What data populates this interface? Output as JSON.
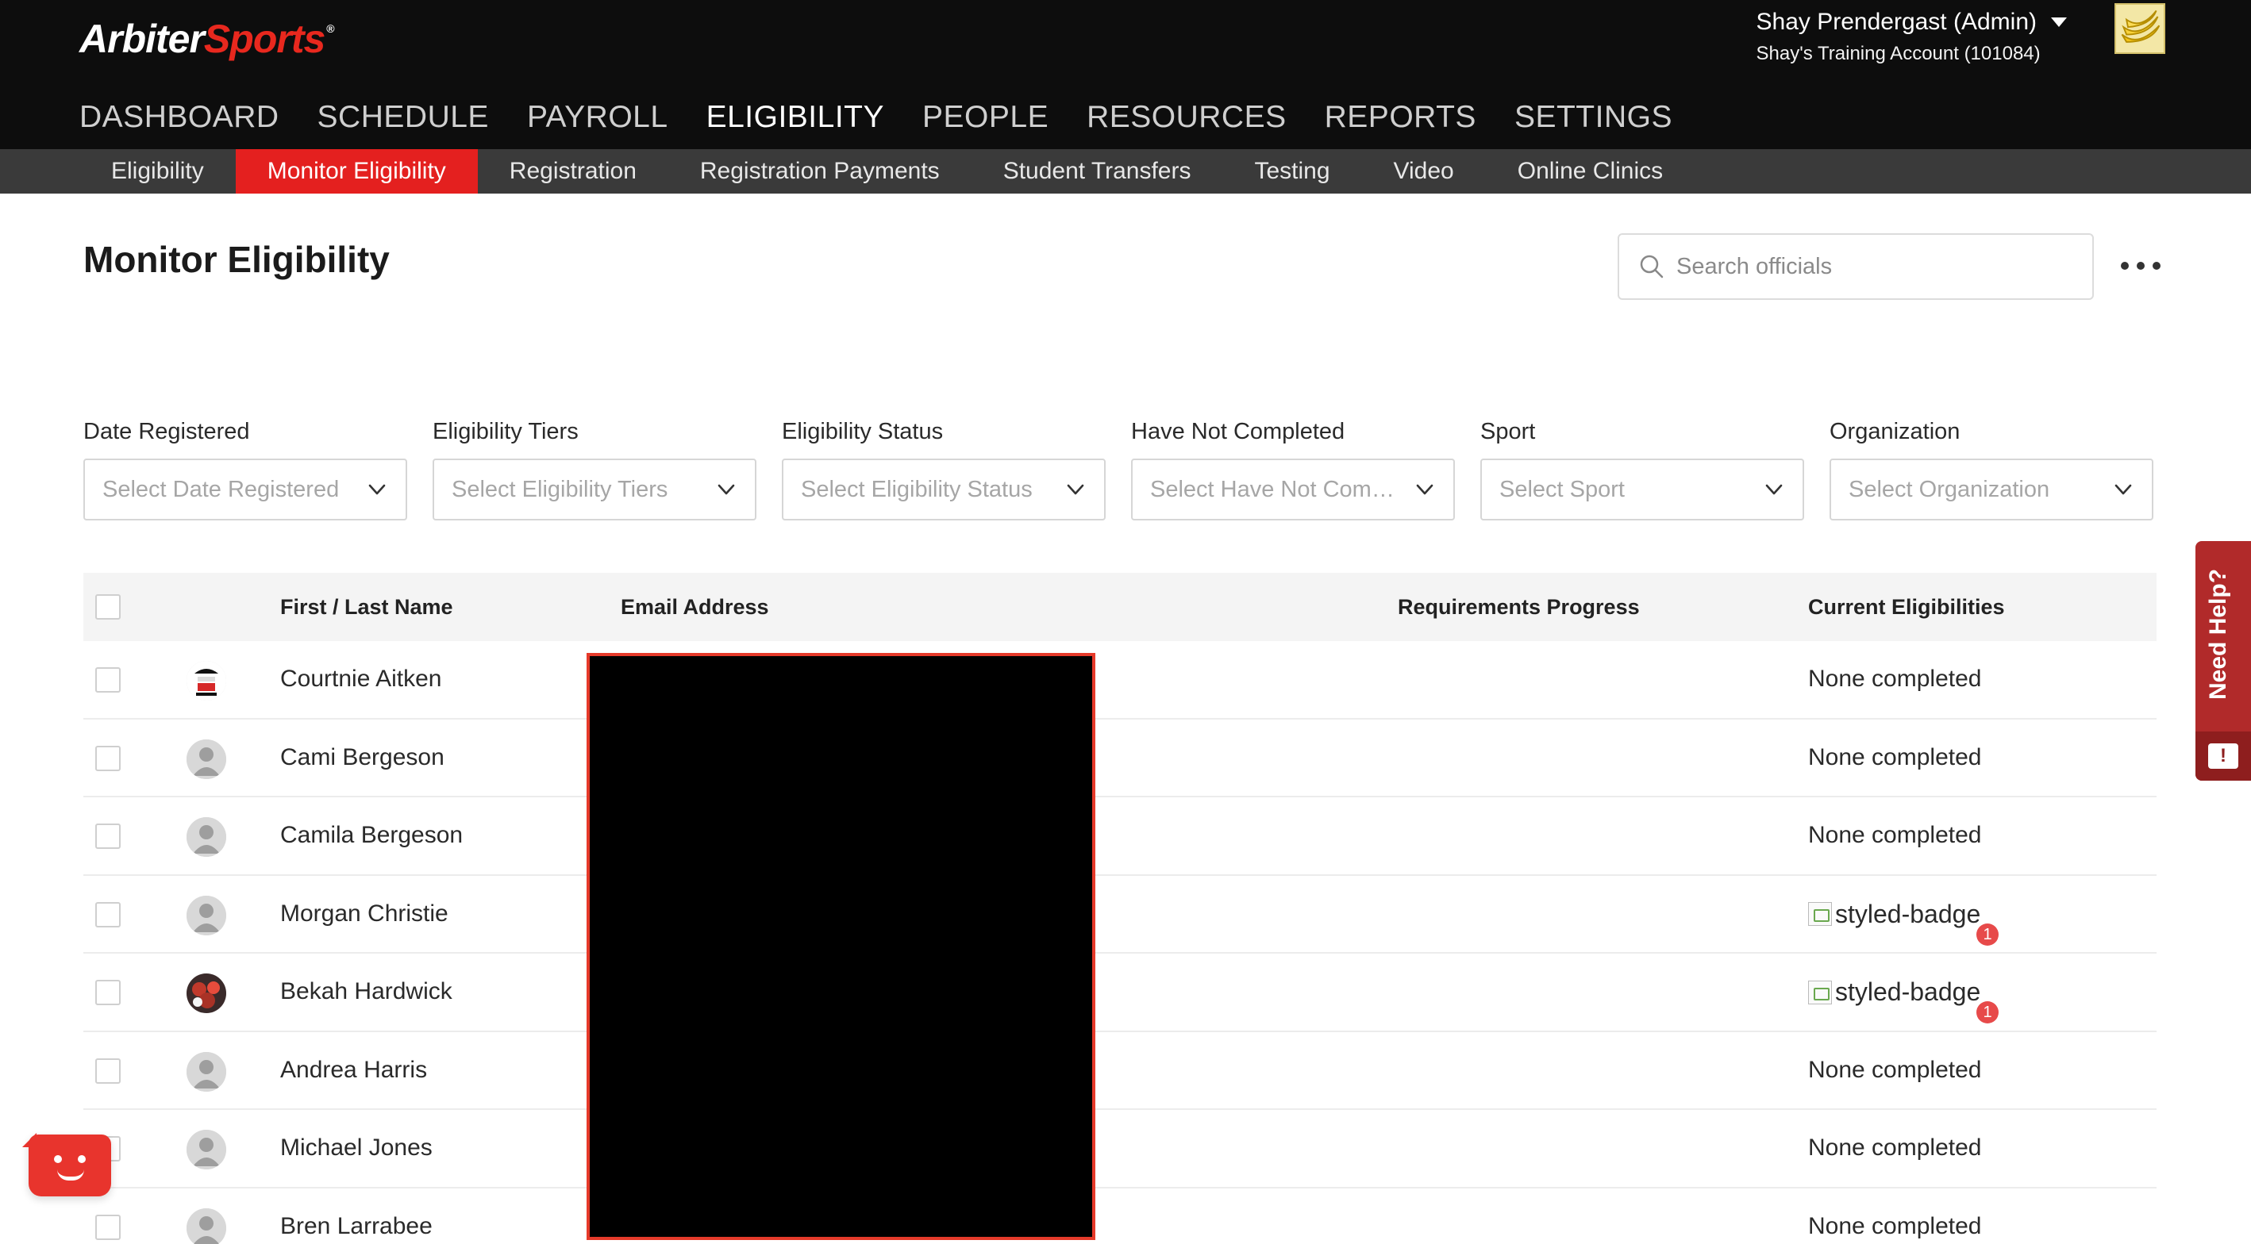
{
  "app": {
    "logo_part1": "Arbiter",
    "logo_part2": "Sports",
    "logo_tm": "®",
    "brand_red": "#e4201f"
  },
  "user": {
    "name": "Shay Prendergast (Admin)",
    "account": "Shay's Training Account (101084)",
    "avatar_icon": "banana-avatar"
  },
  "main_nav": [
    "DASHBOARD",
    "SCHEDULE",
    "PAYROLL",
    "ELIGIBILITY",
    "PEOPLE",
    "RESOURCES",
    "REPORTS",
    "SETTINGS"
  ],
  "main_nav_active": "ELIGIBILITY",
  "sub_nav": [
    "Eligibility",
    "Monitor Eligibility",
    "Registration",
    "Registration Payments",
    "Student Transfers",
    "Testing",
    "Video",
    "Online Clinics"
  ],
  "sub_nav_active": "Monitor Eligibility",
  "page": {
    "title": "Monitor Eligibility",
    "search_placeholder": "Search officials",
    "more_icon": "more-horizontal-icon"
  },
  "filters": [
    {
      "label": "Date Registered",
      "placeholder": "Select Date Registered"
    },
    {
      "label": "Eligibility Tiers",
      "placeholder": "Select Eligibility Tiers"
    },
    {
      "label": "Eligibility Status",
      "placeholder": "Select Eligibility Status"
    },
    {
      "label": "Have Not Completed",
      "placeholder": "Select Have Not Compl..."
    },
    {
      "label": "Sport",
      "placeholder": "Select Sport"
    },
    {
      "label": "Organization",
      "placeholder": "Select Organization"
    }
  ],
  "table": {
    "headers": {
      "name": "First / Last Name",
      "email": "Email Address",
      "progress": "Requirements Progress",
      "eligibilities": "Current Eligibilities"
    },
    "rows": [
      {
        "name": "Courtnie Aitken",
        "avatar": "custom-avatar",
        "eligibility": "None completed",
        "badge_count": null
      },
      {
        "name": "Cami Bergeson",
        "avatar": "default-avatar",
        "eligibility": "None completed",
        "badge_count": null
      },
      {
        "name": "Camila Bergeson",
        "avatar": "default-avatar",
        "eligibility": "None completed",
        "badge_count": null
      },
      {
        "name": "Morgan Christie",
        "avatar": "default-avatar",
        "eligibility": "styled-badge",
        "badge_count": "1"
      },
      {
        "name": "Bekah Hardwick",
        "avatar": "photo-avatar",
        "eligibility": "styled-badge",
        "badge_count": "1"
      },
      {
        "name": "Andrea Harris",
        "avatar": "default-avatar",
        "eligibility": "None completed",
        "badge_count": null
      },
      {
        "name": "Michael Jones",
        "avatar": "default-avatar",
        "eligibility": "None completed",
        "badge_count": null
      },
      {
        "name": "Bren Larrabee",
        "avatar": "default-avatar",
        "eligibility": "None completed",
        "badge_count": null
      }
    ]
  },
  "help_tab": {
    "label": "Need Help?",
    "chat_icon": "chat-alert-icon",
    "chat_glyph": "!"
  },
  "bot": {
    "icon": "chatbot-icon"
  }
}
